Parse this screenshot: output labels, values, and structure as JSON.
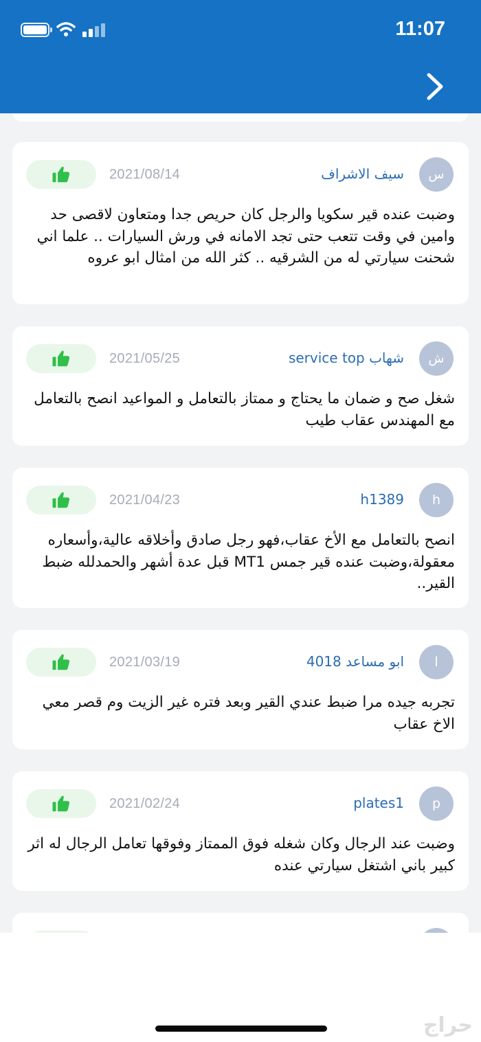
{
  "status_bar": {
    "time": "11:07"
  },
  "header": {
    "back_icon": "chevron-right-icon"
  },
  "reviews": [
    {
      "avatar_letter": "س",
      "name": "سيف الاشراف",
      "date": "2021/08/14",
      "comment": "وضبت عنده قير سكويا والرجل كان حريص جدا ومتعاون لاقصى حد وامين في وقت تتعب حتى تجد الامانه في ورش السيارات  .. علما اني شحنت سيارتي له من الشرقيه ..  كثر الله من امثال ابو عروه"
    },
    {
      "avatar_letter": "ش",
      "name": "شهاب service top",
      "date": "2021/05/25",
      "comment": "شغل صح و ضمان ما يحتاج و ممتاز بالتعامل و المواعيد انصح بالتعامل مع المهندس عقاب طيب"
    },
    {
      "avatar_letter": "h",
      "name": "h1389",
      "date": "2021/04/23",
      "comment": "انصح بالتعامل مع الأخ عقاب،فهو رجل صادق وأخلاقه عالية،وأسعاره معقولة،وضبت عنده قير جمس MT1 قبل عدة أشهر والحمدلله ضبط القير.."
    },
    {
      "avatar_letter": "ا",
      "name": "ابو مساعد 4018",
      "date": "2021/03/19",
      "comment": "تجربه جيده مرا ضبط عندي القير وبعد فتره غير الزيت وم قصر معي الاخ عقاب"
    },
    {
      "avatar_letter": "p",
      "name": "plates1",
      "date": "2021/02/24",
      "comment": "وضبت عند الرجال وكان شغله فوق الممتاز وفوقها  تعامل الرجال له اثر كبير باني اشتغل سيارتي عنده"
    }
  ],
  "like_icon": "thumbs-up-icon",
  "colors": {
    "header": "#1572c4",
    "name": "#2a6cb3",
    "like": "#2fbf4a",
    "like_bg": "#e8f7ea"
  },
  "watermark": "حراج"
}
